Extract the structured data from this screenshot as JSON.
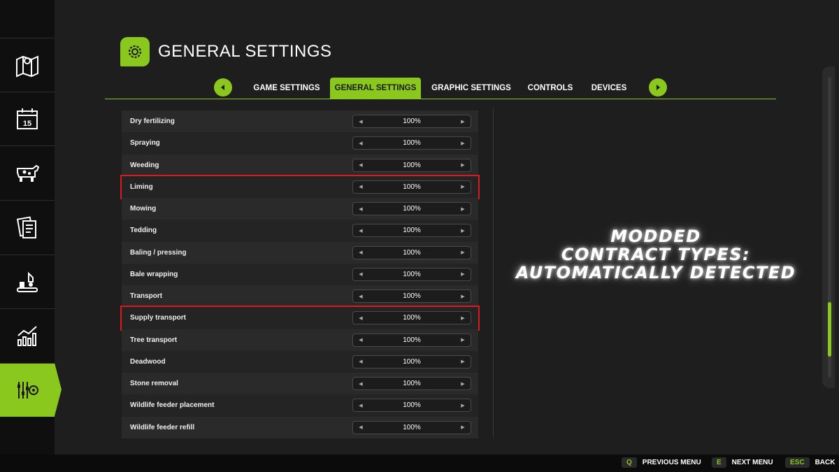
{
  "header": {
    "title": "GENERAL SETTINGS",
    "icon": "gear-icon"
  },
  "nav": {
    "items": [
      {
        "name": "map-icon"
      },
      {
        "name": "calendar-icon",
        "label": "15"
      },
      {
        "name": "animals-icon"
      },
      {
        "name": "contracts-icon"
      },
      {
        "name": "production-icon"
      },
      {
        "name": "statistics-icon"
      },
      {
        "name": "settings-icon",
        "active": true
      }
    ]
  },
  "tabs": [
    {
      "label": "GAME SETTINGS"
    },
    {
      "label": "GENERAL SETTINGS",
      "active": true
    },
    {
      "label": "GRAPHIC SETTINGS"
    },
    {
      "label": "CONTROLS"
    },
    {
      "label": "DEVICES"
    }
  ],
  "settings": [
    {
      "label": "Dry fertilizing",
      "value": "100%"
    },
    {
      "label": "Spraying",
      "value": "100%"
    },
    {
      "label": "Weeding",
      "value": "100%"
    },
    {
      "label": "Liming",
      "value": "100%",
      "highlighted": true
    },
    {
      "label": "Mowing",
      "value": "100%"
    },
    {
      "label": "Tedding",
      "value": "100%"
    },
    {
      "label": "Baling / pressing",
      "value": "100%"
    },
    {
      "label": "Bale wrapping",
      "value": "100%"
    },
    {
      "label": "Transport",
      "value": "100%"
    },
    {
      "label": "Supply transport",
      "value": "100%",
      "highlighted": true
    },
    {
      "label": "Tree transport",
      "value": "100%"
    },
    {
      "label": "Deadwood",
      "value": "100%"
    },
    {
      "label": "Stone removal",
      "value": "100%"
    },
    {
      "label": "Wildlife feeder placement",
      "value": "100%"
    },
    {
      "label": "Wildlife feeder refill",
      "value": "100%"
    }
  ],
  "promo": {
    "line1": "MODDED",
    "line2": "CONTRACT TYPES:",
    "line3": "AUTOMATICALLY DETECTED"
  },
  "footer": {
    "hints": [
      {
        "key": "Q",
        "label": "PREVIOUS MENU"
      },
      {
        "key": "E",
        "label": "NEXT MENU"
      },
      {
        "key": "ESC",
        "label": "BACK"
      }
    ]
  },
  "colors": {
    "accent": "#8ac81e",
    "highlight": "#d81b1b",
    "background": "#1e1e1e"
  }
}
